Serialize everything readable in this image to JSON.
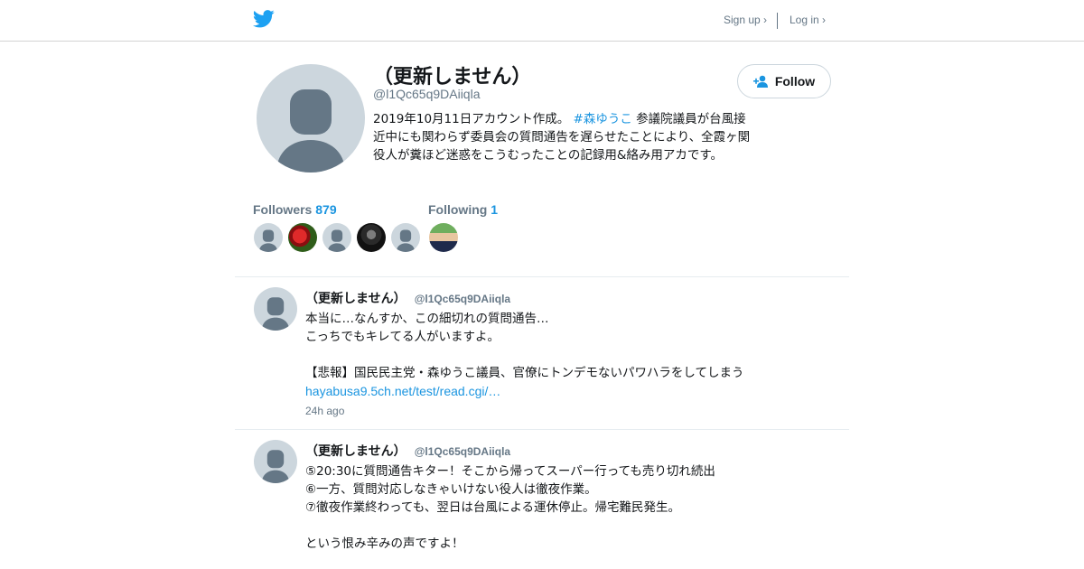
{
  "nav": {
    "signup_label": "Sign up ›",
    "login_label": "Log in ›",
    "logo_icon": "twitter-bird-icon"
  },
  "profile": {
    "name": "（更新しません）",
    "handle": "@l1Qc65q9DAiiqla",
    "bio_prefix": "2019年10月11日アカウント作成。",
    "bio_hashtag": "#森ゆうこ",
    "bio_rest": "参議院議員が台風接近中にも関わらず委員会の質問通告を遅らせたことにより、全霞ヶ関役人が糞ほど迷惑をこうむったことの記録用&絡み用アカです。",
    "follow_label": "Follow",
    "followers_label": "Followers",
    "followers_count": "879",
    "following_label": "Following",
    "following_count": "1"
  },
  "tweets": [
    {
      "name": "（更新しません）",
      "handle": "@l1Qc65q9DAiiqla",
      "lines": [
        "本当に…なんすか、この細切れの質問通告…",
        "こっちでもキレてる人がいますよ。",
        "",
        "【悲報】国民民主党・森ゆうこ議員、官僚にトンデモないパワハラをしてしまう"
      ],
      "link": "hayabusa9.5ch.net/test/read.cgi/…",
      "time": "24h ago"
    },
    {
      "name": "（更新しません）",
      "handle": "@l1Qc65q9DAiiqla",
      "lines": [
        "⑤20:30に質問通告キター！そこから帰ってスーパー行っても売り切れ続出",
        "⑥一方、質問対応しなきゃいけない役人は徹夜作業。",
        "⑦徹夜作業終わっても、翌日は台風による運休停止。帰宅難民発生。",
        "",
        "という恨み辛みの声ですよ！"
      ]
    }
  ],
  "colors": {
    "accent": "#1b95e0",
    "logo": "#1da1f2",
    "muted": "#657786",
    "avatar_bg": "#ccd6dd",
    "avatar_fg": "#657786"
  }
}
